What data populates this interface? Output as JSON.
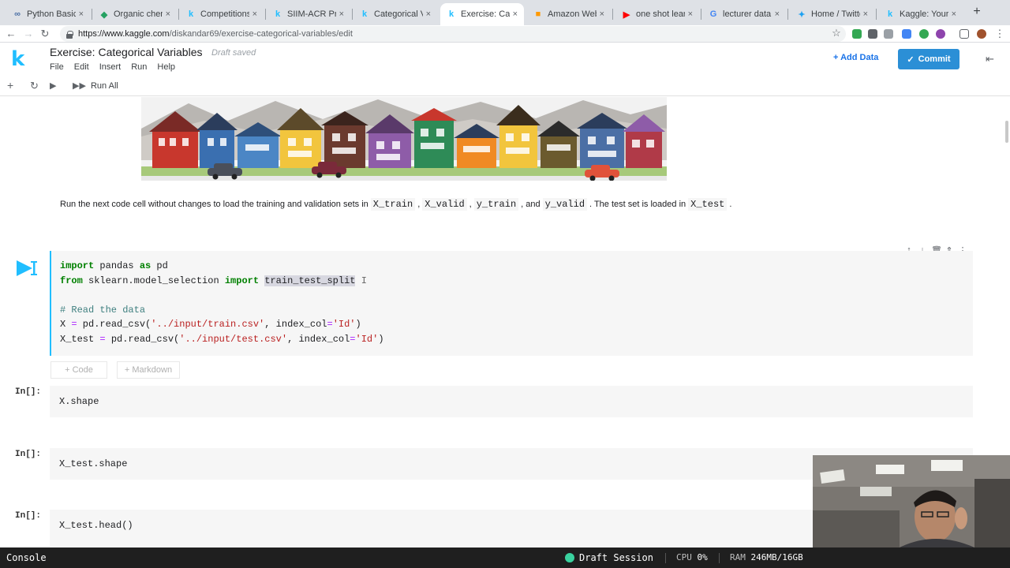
{
  "browser": {
    "tabs": [
      {
        "title": "Python Basics wi",
        "icon": "python-tab-icon",
        "color": "#4a6fa5"
      },
      {
        "title": "Organic chemistr",
        "icon": "bracket-tab-icon",
        "color": "#25a162"
      },
      {
        "title": "Competitions | Ka",
        "icon": "kaggle-tab-icon",
        "color": "#20beff"
      },
      {
        "title": "SIIM-ACR Pneum",
        "icon": "kaggle-tab-icon",
        "color": "#20beff"
      },
      {
        "title": "Categorical Varia",
        "icon": "kaggle-tab-icon",
        "color": "#20beff"
      },
      {
        "title": "Exercise: Catego",
        "icon": "kaggle-tab-icon",
        "color": "#20beff"
      },
      {
        "title": "Amazon Web Ser",
        "icon": "aws-tab-icon",
        "color": "#ff9900"
      },
      {
        "title": "one shot learning",
        "icon": "youtube-tab-icon",
        "color": "#ff0000"
      },
      {
        "title": "lecturer data scie",
        "icon": "google-tab-icon",
        "color": "#4285f4"
      },
      {
        "title": "Home / Twitter",
        "icon": "twitter-tab-icon",
        "color": "#1da1f2"
      },
      {
        "title": "Kaggle: Your Hon",
        "icon": "kaggle-tab-icon",
        "color": "#20beff"
      }
    ],
    "active_tab": 5,
    "url_host": "https://www.kaggle.com",
    "url_path": "/diskandar69/exercise-categorical-variables/edit"
  },
  "header": {
    "logo": "k",
    "title": "Exercise: Categorical Variables",
    "draft_status": "Draft saved",
    "menu": [
      "File",
      "Edit",
      "Insert",
      "Run",
      "Help"
    ],
    "add_data": "Add Data",
    "commit": "Commit"
  },
  "toolbar": {
    "run_all": "Run All"
  },
  "markdown": {
    "t1": "Run the next code cell without changes to load the training and validation sets in",
    "c1": "X_train",
    "t2": ",",
    "c2": "X_valid",
    "t3": ",",
    "c3": "y_train",
    "t4": ", and",
    "c4": "y_valid",
    "t5": ". The test set is loaded in",
    "c5": "X_test",
    "t6": "."
  },
  "active_cell": {
    "l1_kw1": "import",
    "l1_rest": " pandas ",
    "l1_kw2": "as",
    "l1_end": " pd",
    "l2_kw1": "from",
    "l2_mid": " sklearn.model_selection ",
    "l2_kw2": "import",
    "l2_sel": "train_test_split",
    "l4_comment": "# Read the data",
    "l5_a": "X ",
    "l5_eq": "=",
    "l5_b": " pd.read_csv(",
    "l5_str": "'../input/train.csv'",
    "l5_c": ", index_col",
    "l5_eq2": "=",
    "l5_str2": "'Id'",
    "l5_d": ")",
    "l6_a": "X_test ",
    "l6_eq": "=",
    "l6_b": " pd.read_csv(",
    "l6_str": "'../input/test.csv'",
    "l6_c": ", index_col",
    "l6_eq2": "=",
    "l6_str2": "'Id'",
    "l6_d": ")"
  },
  "add_buttons": {
    "code": "+ Code",
    "markdown": "+ Markdown"
  },
  "cells": [
    {
      "prompt": "In[]:",
      "code": "X.shape"
    },
    {
      "prompt": "In[]:",
      "code": "X_test.shape"
    },
    {
      "prompt": "In[]:",
      "code": "X_test.head()"
    }
  ],
  "status": {
    "console": "Console",
    "session": "Draft Session",
    "cpu_label": "CPU",
    "cpu_value": "0%",
    "ram_label": "RAM",
    "ram_value": "246MB/16GB"
  },
  "colors": {
    "kaggle_blue": "#20beff",
    "commit_blue": "#2b8fd6",
    "session_green": "#3ad29f"
  }
}
